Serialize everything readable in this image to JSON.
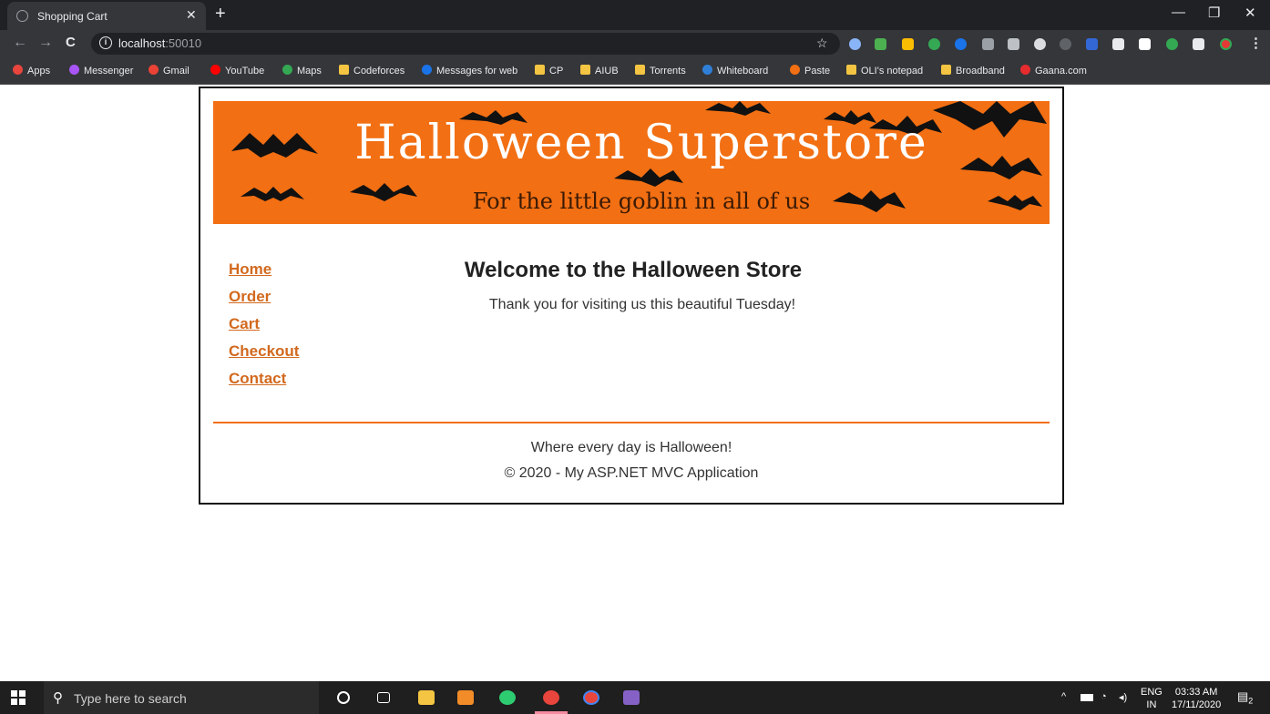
{
  "browser": {
    "tab_title": "Shopping Cart",
    "tab_close": "✕",
    "new_tab": "+",
    "window_controls": {
      "minimize": "—",
      "restore": "❐",
      "close": "✕"
    },
    "nav": {
      "back": "←",
      "forward": "→",
      "reload": "C"
    },
    "address": {
      "host": "localhost",
      "port": ":50010"
    },
    "star": "☆",
    "menu": "⋮"
  },
  "bookmarks": [
    {
      "label": "Apps",
      "icon": "apps-grid-icon",
      "color": "#e8453c"
    },
    {
      "label": "Messenger",
      "icon": "messenger-icon",
      "color": "#a855f7"
    },
    {
      "label": "Gmail",
      "icon": "gmail-icon",
      "color": "#ea4335"
    },
    {
      "label": "YouTube",
      "icon": "youtube-icon",
      "color": "#ff0000"
    },
    {
      "label": "Maps",
      "icon": "maps-icon",
      "color": "#34a853"
    },
    {
      "label": "Codeforces",
      "icon": "folder-icon",
      "color": "#f4c542"
    },
    {
      "label": "Messages for web",
      "icon": "messages-icon",
      "color": "#1a73e8"
    },
    {
      "label": "CP",
      "icon": "folder-icon",
      "color": "#f4c542"
    },
    {
      "label": "AIUB",
      "icon": "folder-icon",
      "color": "#f4c542"
    },
    {
      "label": "Torrents",
      "icon": "folder-icon",
      "color": "#f4c542"
    },
    {
      "label": "Whiteboard",
      "icon": "whiteboard-icon",
      "color": "#2f7fd8"
    },
    {
      "label": "Paste",
      "icon": "paste-icon",
      "color": "#f26f13"
    },
    {
      "label": "OLI's notepad",
      "icon": "folder-icon",
      "color": "#f4c542"
    },
    {
      "label": "Broadband",
      "icon": "folder-icon",
      "color": "#f4c542"
    },
    {
      "label": "Gaana.com",
      "icon": "gaana-icon",
      "color": "#e72c30"
    }
  ],
  "banner": {
    "title": "Halloween Superstore",
    "subtitle": "For the little goblin in all of us"
  },
  "sidebar": {
    "links": [
      {
        "label": "Home"
      },
      {
        "label": "Order"
      },
      {
        "label": "Cart"
      },
      {
        "label": "Checkout"
      },
      {
        "label": "Contact"
      }
    ]
  },
  "main": {
    "heading": "Welcome to the Halloween Store",
    "message": "Thank you for visiting us this beautiful Tuesday!"
  },
  "footer": {
    "tagline": "Where every day is Halloween!",
    "copyright": "© 2020 - My ASP.NET MVC Application"
  },
  "taskbar": {
    "search_placeholder": "Type here to search",
    "lang_top": "ENG",
    "lang_bottom": "IN",
    "time": "03:33 AM",
    "date": "17/11/2020",
    "notification_count": "2"
  },
  "colors": {
    "accent": "#f26f13",
    "link": "#d2691e"
  }
}
